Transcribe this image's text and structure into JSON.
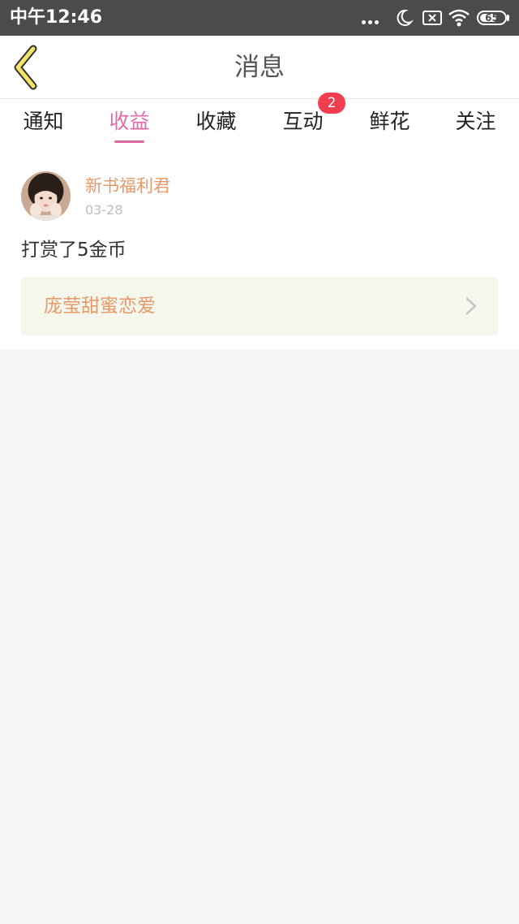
{
  "status_bar": {
    "time": "中午12:46",
    "battery": "65"
  },
  "header": {
    "title": "消息"
  },
  "tabs": [
    {
      "label": "通知"
    },
    {
      "label": "收益",
      "active": true
    },
    {
      "label": "收藏"
    },
    {
      "label": "互动",
      "badge": "2"
    },
    {
      "label": "鲜花"
    },
    {
      "label": "关注"
    }
  ],
  "message": {
    "sender": "新书福利君",
    "date": "03-28",
    "text": "打赏了5金币",
    "book_title": "庞莹甜蜜恋爱"
  },
  "colors": {
    "accent": "#e06aa6",
    "orange_text": "#e69a6b",
    "badge": "#f03e4e",
    "back_arrow": "#f2e266",
    "book_link_bg": "#f5f7ec"
  }
}
